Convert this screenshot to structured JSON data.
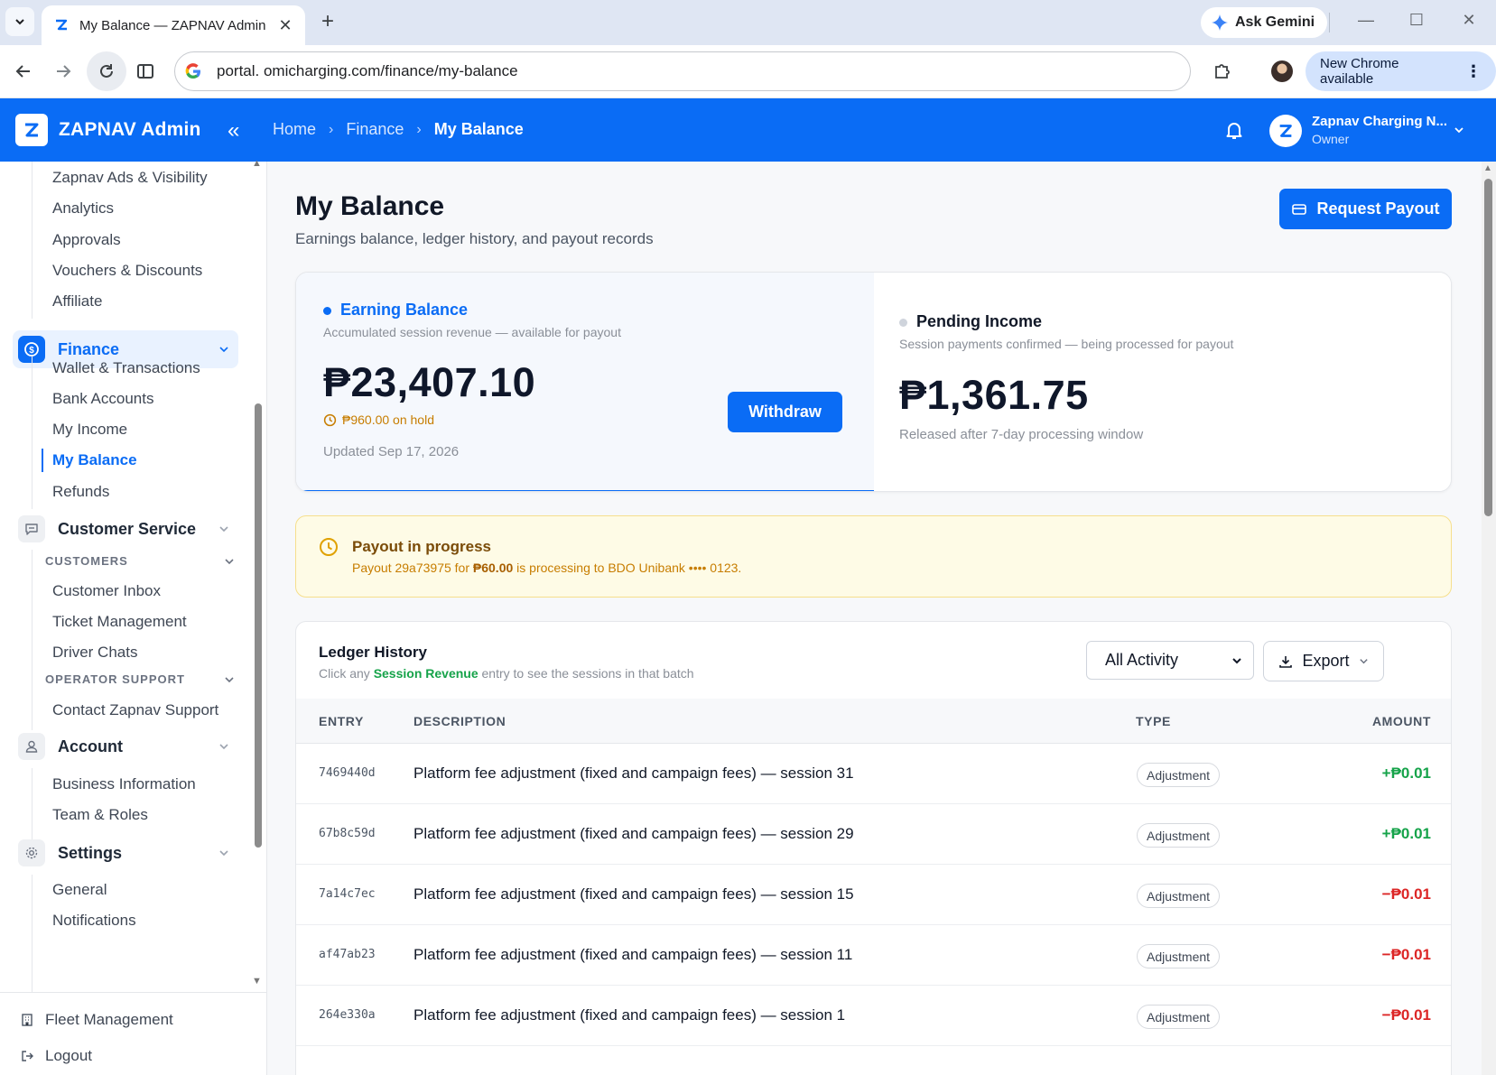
{
  "browser": {
    "tab_title": "My Balance — ZAPNAV Admin",
    "url": "portal. omicharging.com/finance/my-balance",
    "gemini_label": "Ask Gemini",
    "update_label": "New Chrome available"
  },
  "app": {
    "brand": "ZAPNAV Admin",
    "breadcrumbs": [
      "Home",
      "Finance",
      "My Balance"
    ],
    "org_name": "Zapnav Charging N...",
    "org_role": "Owner",
    "colors": {
      "primary": "#0a6cf5",
      "positive": "#16a34a",
      "negative": "#dc2626",
      "warning": "#c77d00"
    }
  },
  "sidebar": {
    "top_items": [
      "Zapnav Ads & Visibility",
      "Analytics",
      "Approvals",
      "Vouchers & Discounts",
      "Affiliate"
    ],
    "finance": {
      "label": "Finance",
      "items": [
        "Wallet & Transactions",
        "Bank Accounts",
        "My Income",
        "My Balance",
        "Refunds"
      ],
      "active": "My Balance"
    },
    "customer_service": {
      "label": "Customer Service",
      "section_customers": "CUSTOMERS",
      "customer_items": [
        "Customer Inbox",
        "Ticket Management",
        "Driver Chats"
      ],
      "section_operator": "OPERATOR SUPPORT",
      "operator_items": [
        "Contact Zapnav Support"
      ]
    },
    "account": {
      "label": "Account",
      "items": [
        "Business Information",
        "Team & Roles"
      ]
    },
    "settings": {
      "label": "Settings",
      "items": [
        "General",
        "Notifications"
      ]
    },
    "bottom": {
      "fleet": "Fleet Management",
      "logout": "Logout"
    }
  },
  "page": {
    "title": "My Balance",
    "subtitle": "Earnings balance, ledger history, and payout records",
    "request_payout_label": "Request Payout"
  },
  "earning": {
    "label": "Earning Balance",
    "description": "Accumulated session revenue — available for payout",
    "amount": "₱23,407.10",
    "on_hold": "₱960.00 on hold",
    "updated": "Updated Sep 17, 2026",
    "withdraw_label": "Withdraw"
  },
  "pending": {
    "label": "Pending Income",
    "description": "Session payments confirmed — being processed for payout",
    "amount": "₱1,361.75",
    "note": "Released after 7-day processing window"
  },
  "alert": {
    "title": "Payout in progress",
    "prefix": "Payout 29a73975 for ",
    "amount": "₱60.00",
    "suffix": " is processing to BDO Unibank •••• 0123."
  },
  "ledger": {
    "title": "Ledger History",
    "sub_prefix": "Click any ",
    "sub_highlight": "Session Revenue",
    "sub_suffix": " entry to see the sessions in that batch",
    "filter_value": "All Activity",
    "export_label": "Export",
    "columns": [
      "ENTRY",
      "DESCRIPTION",
      "TYPE",
      "AMOUNT"
    ],
    "rows": [
      {
        "id": "7469440d",
        "description": "Platform fee adjustment (fixed and campaign fees) — session 31",
        "type": "Adjustment",
        "amount": "+₱0.01",
        "sign": "pos"
      },
      {
        "id": "67b8c59d",
        "description": "Platform fee adjustment (fixed and campaign fees) — session 29",
        "type": "Adjustment",
        "amount": "+₱0.01",
        "sign": "pos"
      },
      {
        "id": "7a14c7ec",
        "description": "Platform fee adjustment (fixed and campaign fees) — session 15",
        "type": "Adjustment",
        "amount": "−₱0.01",
        "sign": "neg"
      },
      {
        "id": "af47ab23",
        "description": "Platform fee adjustment (fixed and campaign fees) — session 11",
        "type": "Adjustment",
        "amount": "−₱0.01",
        "sign": "neg"
      },
      {
        "id": "264e330a",
        "description": "Platform fee adjustment (fixed and campaign fees) — session 1",
        "type": "Adjustment",
        "amount": "−₱0.01",
        "sign": "neg"
      }
    ]
  }
}
